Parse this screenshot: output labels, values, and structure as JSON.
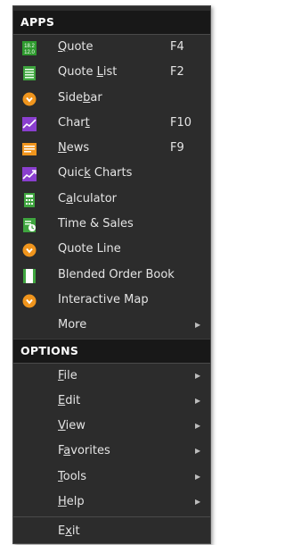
{
  "apps": {
    "header": "APPS",
    "items": [
      {
        "label": "Quote",
        "shortcut": "F4",
        "icon": "quote-icon",
        "color": "#2e9a2e",
        "underline": "Q"
      },
      {
        "label": "Quote List",
        "shortcut": "F2",
        "icon": "list-icon",
        "color": "#3fa53f",
        "underline": "L"
      },
      {
        "label": "Sidebar",
        "shortcut": "",
        "icon": "sidebar-icon",
        "color": "#f0951d",
        "underline": "b"
      },
      {
        "label": "Chart",
        "shortcut": "F10",
        "icon": "chart-icon",
        "color": "#8a3fcf",
        "underline": "t"
      },
      {
        "label": "News",
        "shortcut": "F9",
        "icon": "news-icon",
        "color": "#f0951d",
        "underline": "N"
      },
      {
        "label": "Quick Charts",
        "shortcut": "",
        "icon": "quick-charts-icon",
        "color": "#8a3fcf",
        "underline": "k"
      },
      {
        "label": "Calculator",
        "shortcut": "",
        "icon": "calculator-icon",
        "color": "#3fa53f",
        "underline": "a"
      },
      {
        "label": "Time & Sales",
        "shortcut": "",
        "icon": "time-sales-icon",
        "color": "#3fa53f",
        "underline": ""
      },
      {
        "label": "Quote Line",
        "shortcut": "",
        "icon": "quote-line-icon",
        "color": "#f0951d",
        "underline": ""
      },
      {
        "label": "Blended Order Book",
        "shortcut": "",
        "icon": "order-book-icon",
        "color": "#3fa53f",
        "underline": ""
      },
      {
        "label": "Interactive Map",
        "shortcut": "",
        "icon": "map-icon",
        "color": "#f0951d",
        "underline": ""
      },
      {
        "label": "More",
        "shortcut": "",
        "icon": "",
        "color": "",
        "underline": ""
      }
    ],
    "more_arrow": "▶"
  },
  "options": {
    "header": "OPTIONS",
    "items": [
      {
        "label": "File",
        "underline": "F"
      },
      {
        "label": "Edit",
        "underline": "E"
      },
      {
        "label": "View",
        "underline": "V"
      },
      {
        "label": "Favorites",
        "underline": "a"
      },
      {
        "label": "Tools",
        "underline": "T"
      },
      {
        "label": "Help",
        "underline": "H"
      }
    ],
    "arrow": "▶"
  },
  "exit": {
    "label": "Exit",
    "underline": "x"
  }
}
